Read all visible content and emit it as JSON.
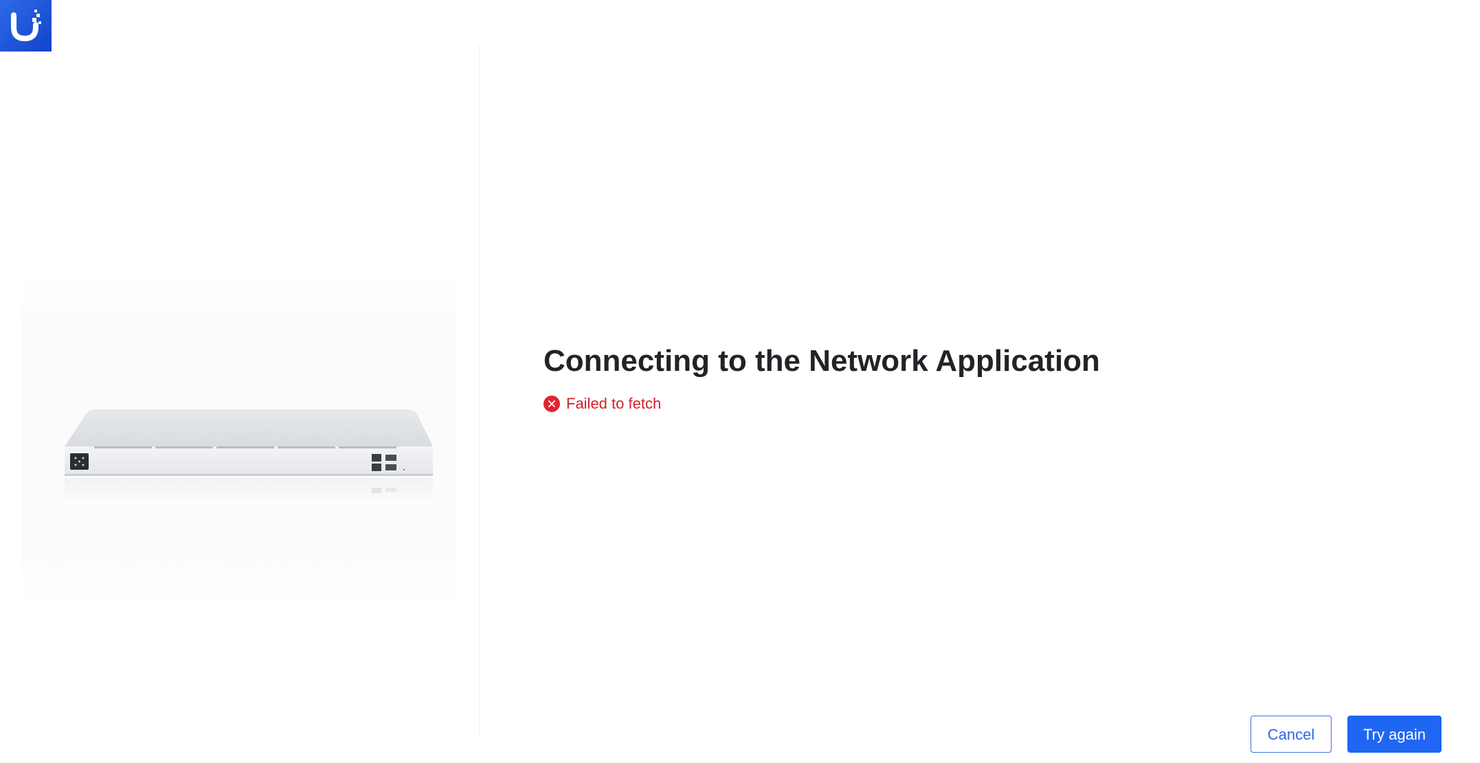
{
  "brand": {
    "logo_icon": "ubiquiti-u-logo-icon",
    "logo_color": "#1f5fe6"
  },
  "product": {
    "image_icon": "network-appliance-illustration"
  },
  "main": {
    "title": "Connecting to the Network Application",
    "error": {
      "icon": "error-x-circle-icon",
      "text": "Failed to fetch",
      "color": "#d0202a"
    }
  },
  "actions": {
    "cancel_label": "Cancel",
    "retry_label": "Try again",
    "primary_color": "#1f67f3"
  }
}
